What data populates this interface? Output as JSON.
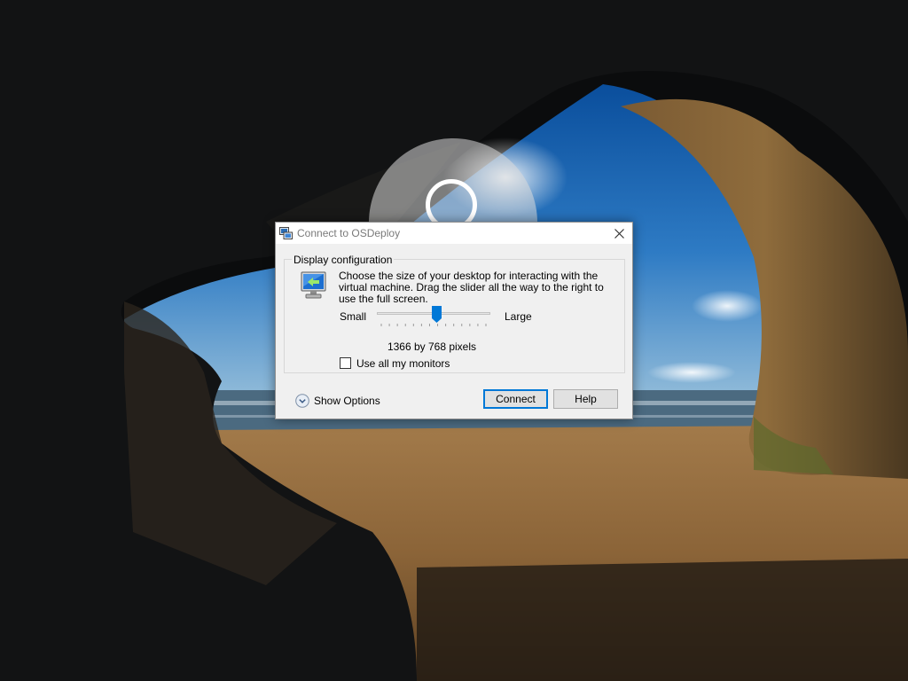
{
  "dialog": {
    "title": "Connect to OSDeploy",
    "app_icon": "remote-desktop-icon",
    "close_icon": "close-icon",
    "group_title": "Display configuration",
    "description": "Choose the size of your desktop for interacting with the virtual machine. Drag the slider all the way to the right to use the full screen.",
    "monitor_icon": "monitor-icon",
    "slider": {
      "min_label": "Small",
      "max_label": "Large",
      "value_fraction": 0.53,
      "tick_count": 14
    },
    "resolution_text": "1366 by 768 pixels",
    "use_all_monitors": {
      "label": "Use all my monitors",
      "checked": false
    },
    "show_options": {
      "label": "Show Options",
      "icon": "chevron-down-circle-icon"
    },
    "buttons": {
      "connect": "Connect",
      "help": "Help"
    },
    "colors": {
      "accent": "#0078d7",
      "dialog_bg": "#f0f0f0",
      "title_text": "#7a7a7a"
    }
  }
}
